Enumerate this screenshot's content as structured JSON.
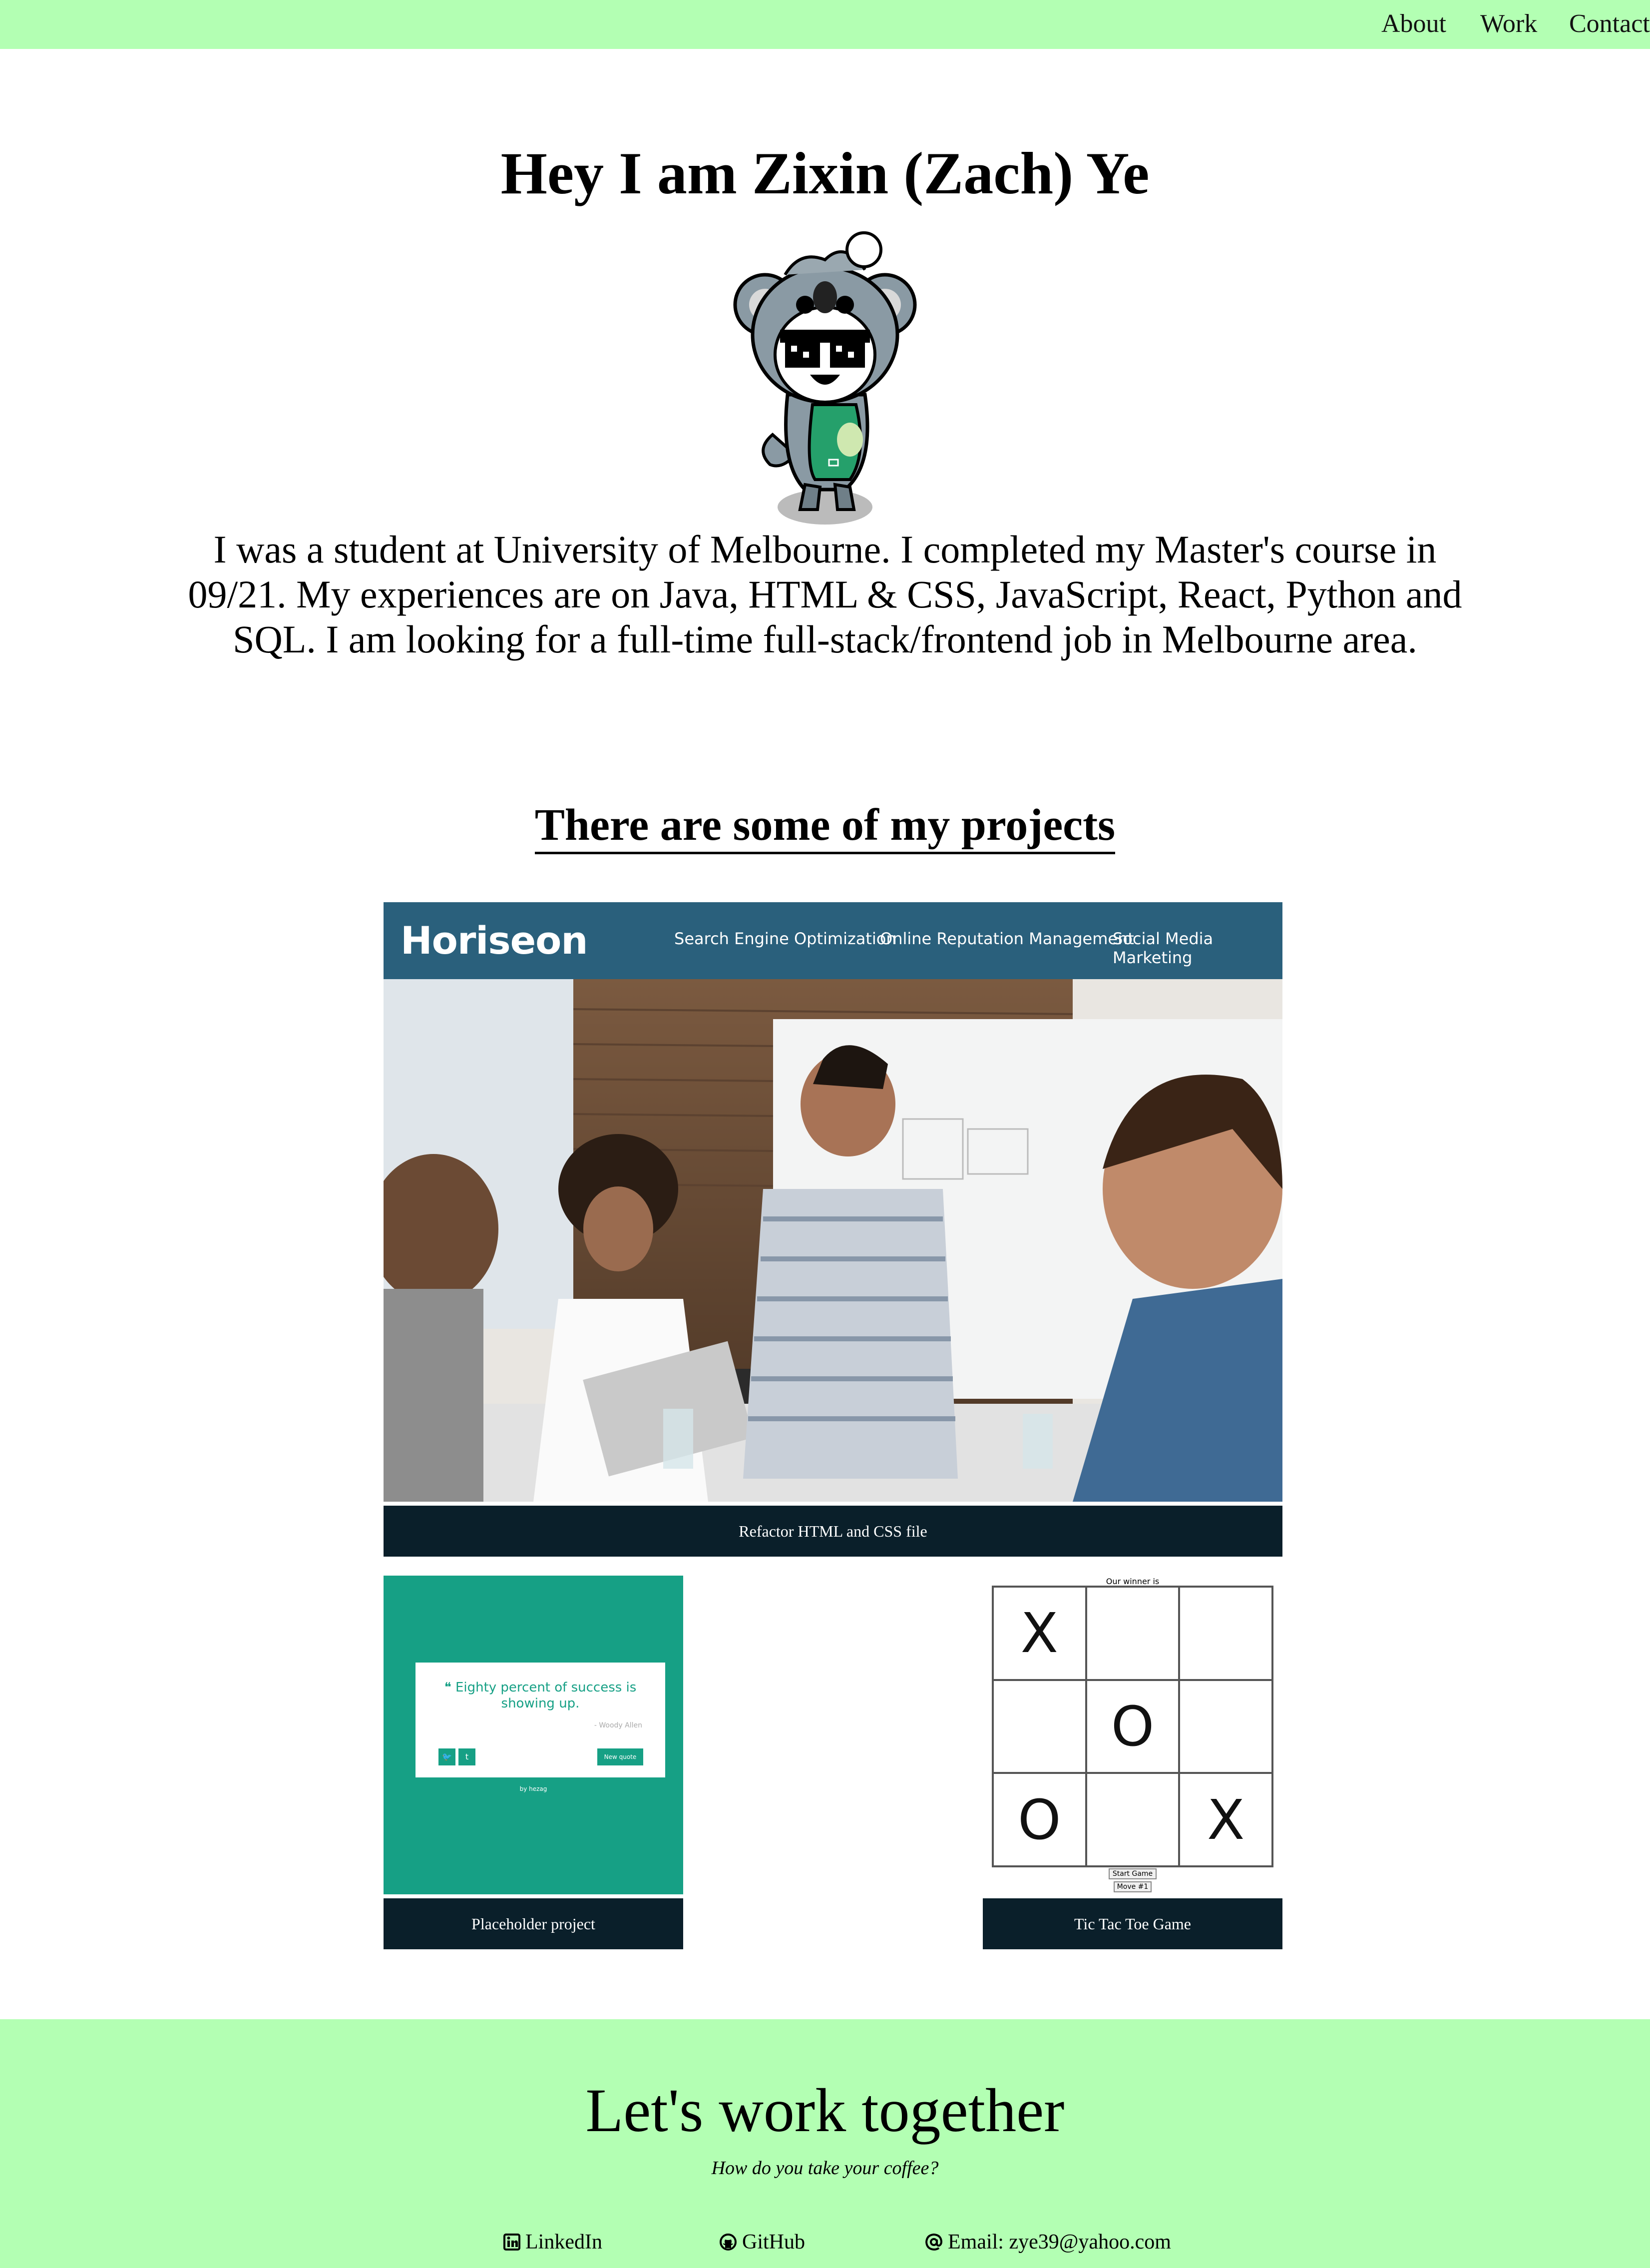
{
  "nav": {
    "about": "About",
    "work": "Work",
    "contact": "Contact"
  },
  "hero": {
    "title": "Hey I am Zixin (Zach) Ye",
    "intro": "I was a student at University of Melbourne. I completed my Master's course in 09/21. My experiences are on Java, HTML & CSS, JavaScript, React, Python and SQL. I am looking for a full-time full-stack/frontend job in Melbourne area."
  },
  "projects": {
    "heading": "There are some of my projects",
    "horiseon": {
      "logo": "Horiseon",
      "nav": [
        "Search Engine Optimization",
        "Online Reputation Management",
        "Social Media Marketing"
      ],
      "caption": "Refactor HTML and CSS file"
    },
    "quote": {
      "text": "Eighty percent of success is showing up.",
      "author": "- Woody Allen",
      "new_quote": "New quote",
      "by": "by hezag",
      "caption": "Placeholder project"
    },
    "tictactoe": {
      "winner_label": "Our winner is",
      "cells": [
        "X",
        "",
        "",
        "",
        "O",
        "",
        "O",
        "",
        "X"
      ],
      "start": "Start Game",
      "move": "Move #1",
      "caption": "Tic Tac Toe Game"
    }
  },
  "footer": {
    "title": "Let's work together",
    "subtitle": "How do you take your coffee?",
    "linkedin": "LinkedIn",
    "github": "GitHub",
    "email": "Email: zye39@yahoo.com"
  },
  "colors": {
    "nav_bg": "#b3ffb3",
    "footer_bg": "#b3ffb3",
    "caption_bg": "#0a1f2a",
    "horiseon_header": "#2a607c",
    "quote_bg": "#16a085"
  }
}
